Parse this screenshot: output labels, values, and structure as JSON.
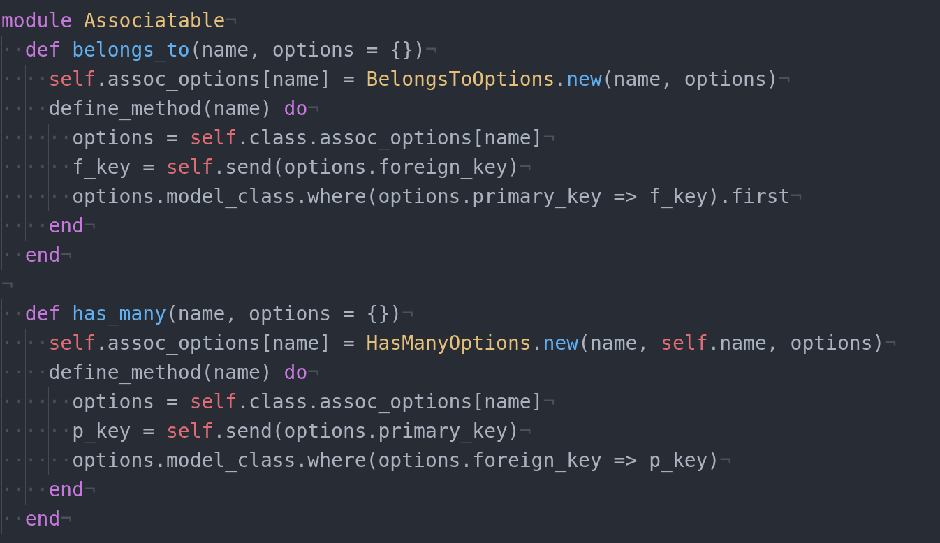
{
  "editor": {
    "lines": [
      {
        "eol": "¬",
        "tokens": [
          {
            "kind": "keyword",
            "text": "module "
          },
          {
            "kind": "constant",
            "text": "Associatable"
          }
        ]
      },
      {
        "indent": "··",
        "eol": "¬",
        "tokens": [
          {
            "kind": "keyword",
            "text": "def "
          },
          {
            "kind": "function",
            "text": "belongs_to"
          },
          {
            "kind": "plain",
            "text": "(name, options = {})"
          }
        ]
      },
      {
        "indent": "····",
        "eol": "¬",
        "tokens": [
          {
            "kind": "self",
            "text": "self"
          },
          {
            "kind": "plain",
            "text": ".assoc_options[name] = "
          },
          {
            "kind": "constant",
            "text": "BelongsToOptions"
          },
          {
            "kind": "plain",
            "text": "."
          },
          {
            "kind": "function",
            "text": "new"
          },
          {
            "kind": "plain",
            "text": "(name, options)"
          }
        ]
      },
      {
        "indent": "····",
        "eol": "¬",
        "tokens": [
          {
            "kind": "plain",
            "text": "define_method(name) "
          },
          {
            "kind": "keyword",
            "text": "do"
          }
        ]
      },
      {
        "indent": "······",
        "eol": "¬",
        "tokens": [
          {
            "kind": "plain",
            "text": "options = "
          },
          {
            "kind": "self",
            "text": "self"
          },
          {
            "kind": "plain",
            "text": ".class.assoc_options[name]"
          }
        ]
      },
      {
        "indent": "······",
        "eol": "¬",
        "tokens": [
          {
            "kind": "plain",
            "text": "f_key = "
          },
          {
            "kind": "self",
            "text": "self"
          },
          {
            "kind": "plain",
            "text": ".send(options.foreign_key)"
          }
        ]
      },
      {
        "indent": "······",
        "eol": "¬",
        "tokens": [
          {
            "kind": "plain",
            "text": "options.model_class.where(options.primary_key => f_key).first"
          }
        ]
      },
      {
        "indent": "····",
        "eol": "¬",
        "tokens": [
          {
            "kind": "keyword",
            "text": "end"
          }
        ]
      },
      {
        "indent": "··",
        "eol": "¬",
        "tokens": [
          {
            "kind": "keyword",
            "text": "end"
          }
        ]
      },
      {
        "eol": "¬"
      },
      {
        "indent": "··",
        "eol": "¬",
        "tokens": [
          {
            "kind": "keyword",
            "text": "def "
          },
          {
            "kind": "function",
            "text": "has_many"
          },
          {
            "kind": "plain",
            "text": "(name, options = {})"
          }
        ]
      },
      {
        "indent": "····",
        "eol": "¬",
        "tokens": [
          {
            "kind": "self",
            "text": "self"
          },
          {
            "kind": "plain",
            "text": ".assoc_options[name] = "
          },
          {
            "kind": "constant",
            "text": "HasManyOptions"
          },
          {
            "kind": "plain",
            "text": "."
          },
          {
            "kind": "function",
            "text": "new"
          },
          {
            "kind": "plain",
            "text": "(name, "
          },
          {
            "kind": "self",
            "text": "self"
          },
          {
            "kind": "plain",
            "text": ".name, options)"
          }
        ]
      },
      {
        "indent": "····",
        "eol": "¬",
        "tokens": [
          {
            "kind": "plain",
            "text": "define_method(name) "
          },
          {
            "kind": "keyword",
            "text": "do"
          }
        ]
      },
      {
        "indent": "······",
        "eol": "¬",
        "tokens": [
          {
            "kind": "plain",
            "text": "options = "
          },
          {
            "kind": "self",
            "text": "self"
          },
          {
            "kind": "plain",
            "text": ".class.assoc_options[name]"
          }
        ]
      },
      {
        "indent": "······",
        "eol": "¬",
        "tokens": [
          {
            "kind": "plain",
            "text": "p_key = "
          },
          {
            "kind": "self",
            "text": "self"
          },
          {
            "kind": "plain",
            "text": ".send(options.primary_key)"
          }
        ]
      },
      {
        "indent": "······",
        "eol": "¬",
        "tokens": [
          {
            "kind": "plain",
            "text": "options.model_class.where(options.foreign_key => p_key)"
          }
        ]
      },
      {
        "indent": "····",
        "eol": "¬",
        "tokens": [
          {
            "kind": "keyword",
            "text": "end"
          }
        ]
      },
      {
        "indent": "··",
        "eol": "¬",
        "tokens": [
          {
            "kind": "keyword",
            "text": "end"
          }
        ]
      }
    ]
  }
}
